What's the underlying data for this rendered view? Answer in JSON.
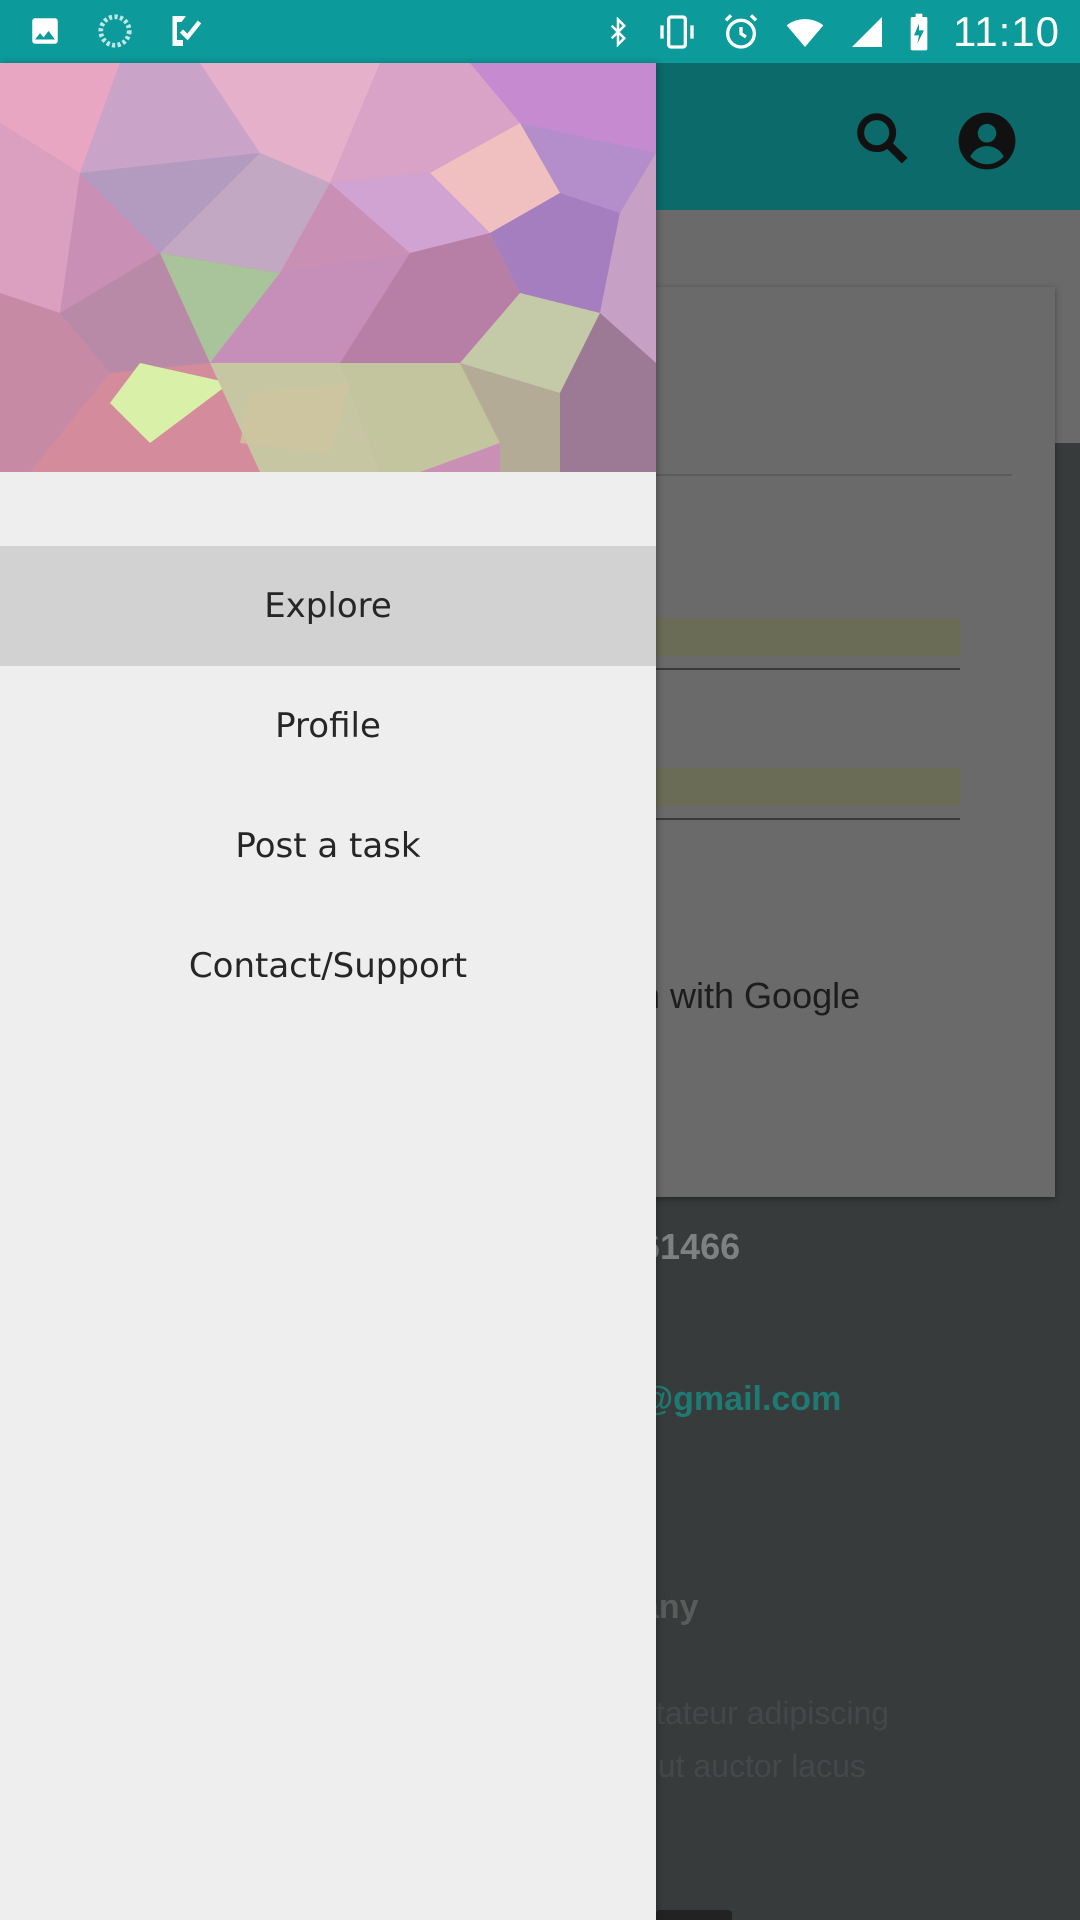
{
  "status_bar": {
    "time": "11:10",
    "left_icons": [
      "image-icon",
      "loading-icon",
      "task-check-icon"
    ],
    "right_icons": [
      "bluetooth-icon",
      "vibrate-icon",
      "alarm-icon",
      "wifi-icon",
      "signal-icon",
      "battery-icon"
    ]
  },
  "drawer": {
    "menu": [
      {
        "label": "Explore",
        "active": true
      },
      {
        "label": "Profile",
        "active": false
      },
      {
        "label": "Post a task",
        "active": false
      },
      {
        "label": "Contact/Support",
        "active": false
      }
    ]
  },
  "background": {
    "google_text": "n with Google",
    "phone_text": "61466",
    "email_text": "@gmail.com",
    "company_text": "any",
    "desc_line1": "ctateur adipiscing",
    "desc_line2": ", ut auctor lacus"
  },
  "colors": {
    "status_bar": "#0c9a9a",
    "app_bar_dimmed": "#0c6a6a",
    "drawer_bg": "#eeeeee",
    "active_item": "#d2d2d2"
  }
}
